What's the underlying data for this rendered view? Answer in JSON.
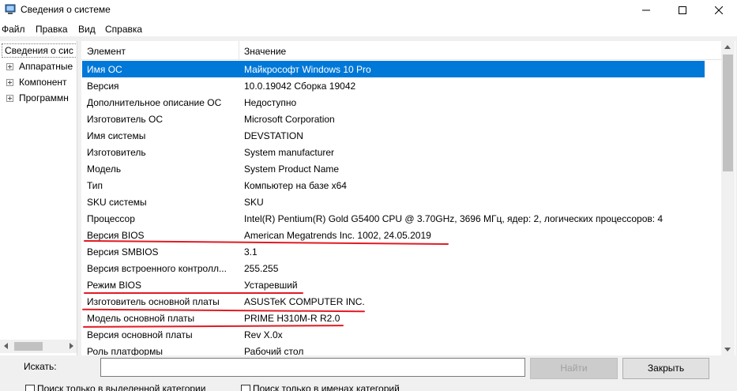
{
  "window": {
    "title": "Сведения о системе",
    "app_icon": "system-information-icon"
  },
  "menu": [
    "Файл",
    "Правка",
    "Вид",
    "Справка"
  ],
  "tree": {
    "root": "Сведения о сис",
    "children": [
      "Аппаратные",
      "Компонент",
      "Программн"
    ]
  },
  "table": {
    "headers": [
      "Элемент",
      "Значение"
    ],
    "rows": [
      {
        "item": "Имя ОС",
        "value": "Майкрософт Windows 10 Pro"
      },
      {
        "item": "Версия",
        "value": "10.0.19042 Сборка 19042"
      },
      {
        "item": "Дополнительное описание ОС",
        "value": "Недоступно"
      },
      {
        "item": "Изготовитель ОС",
        "value": "Microsoft Corporation"
      },
      {
        "item": "Имя системы",
        "value": "DEVSTATION"
      },
      {
        "item": "Изготовитель",
        "value": "System manufacturer"
      },
      {
        "item": "Модель",
        "value": "System Product Name"
      },
      {
        "item": "Тип",
        "value": "Компьютер на базе x64"
      },
      {
        "item": "SKU системы",
        "value": "SKU"
      },
      {
        "item": "Процессор",
        "value": "Intel(R) Pentium(R) Gold G5400 CPU @ 3.70GHz, 3696 МГц, ядер: 2, логических процессоров: 4"
      },
      {
        "item": "Версия BIOS",
        "value": "American Megatrends Inc. 1002, 24.05.2019"
      },
      {
        "item": "Версия SMBIOS",
        "value": "3.1"
      },
      {
        "item": "Версия встроенного контролл...",
        "value": "255.255"
      },
      {
        "item": "Режим BIOS",
        "value": "Устаревший"
      },
      {
        "item": "Изготовитель основной платы",
        "value": "ASUSTeK COMPUTER INC."
      },
      {
        "item": "Модель основной платы",
        "value": "PRIME H310M-R R2.0"
      },
      {
        "item": "Версия основной платы",
        "value": "Rev X.0x"
      },
      {
        "item": "Роль платформы",
        "value": "Рабочий стол"
      }
    ],
    "selected_row": 0
  },
  "search": {
    "label": "Искать:",
    "value": "",
    "find_button": "Найти",
    "close_button": "Закрыть",
    "checkbox_selected_category": "Поиск только в выделенной категории",
    "checkbox_category_names": "Поиск только в именах категорий"
  },
  "colors": {
    "selection": "#0078d7",
    "annotation": "#e21b23"
  }
}
